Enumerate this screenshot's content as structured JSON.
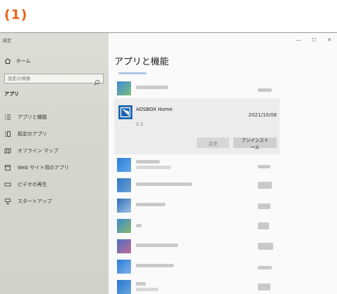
{
  "step_label": "(1)",
  "sidebar": {
    "title": "設定",
    "home_label": "ホーム",
    "search_placeholder": "設定の検索",
    "section_label": "アプリ",
    "items": [
      {
        "label": "アプリと機能",
        "icon": "list-icon"
      },
      {
        "label": "既定のアプリ",
        "icon": "default-apps-icon"
      },
      {
        "label": "オフライン マップ",
        "icon": "map-icon"
      },
      {
        "label": "Web サイト用のアプリ",
        "icon": "web-apps-icon"
      },
      {
        "label": "ビデオの再生",
        "icon": "video-icon"
      },
      {
        "label": "スタートアップ",
        "icon": "startup-icon"
      }
    ]
  },
  "window_controls": {
    "minimize": "—",
    "maximize": "☐",
    "close": "✕"
  },
  "main": {
    "title": "アプリと機能",
    "selected_app": {
      "name": "AOSBOX Home",
      "date": "2021/10/08",
      "version": "2.2",
      "modify_label": "変更",
      "uninstall_label": "アンインストール"
    }
  },
  "colors": {
    "accent": "#1f66b0",
    "step_label": "#e8651a"
  }
}
